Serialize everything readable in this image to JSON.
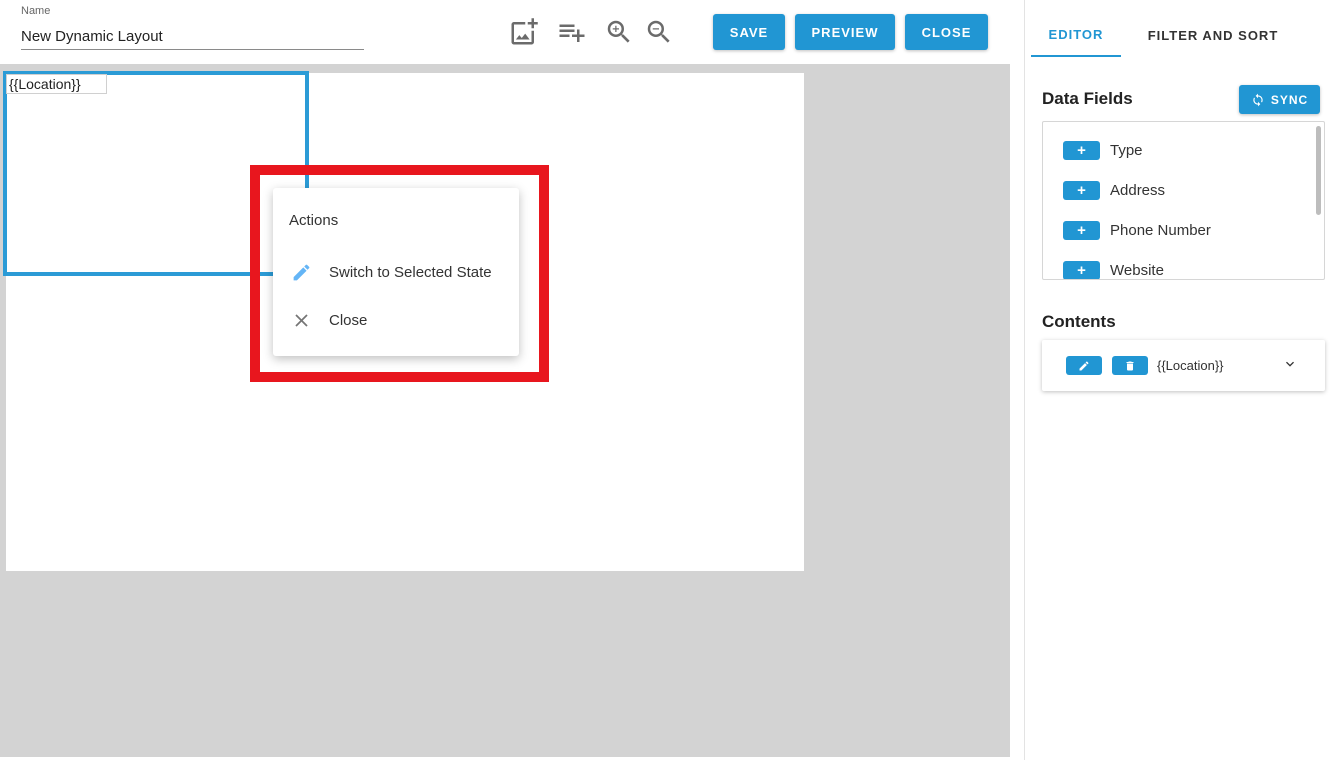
{
  "header": {
    "name_label": "Name",
    "name_value": "New Dynamic Layout",
    "tools": [
      "add-image-icon",
      "add-list-icon",
      "zoom-in-icon",
      "zoom-out-icon"
    ],
    "save_label": "SAVE",
    "preview_label": "PREVIEW",
    "close_label": "CLOSE"
  },
  "canvas": {
    "element_text": "{{Location}}"
  },
  "context_menu": {
    "title": "Actions",
    "items": [
      {
        "label": "Switch to Selected State",
        "icon": "pencil-icon"
      },
      {
        "label": "Close",
        "icon": "close-icon"
      }
    ]
  },
  "panel": {
    "tabs": [
      "EDITOR",
      "FILTER AND SORT"
    ],
    "active_tab": "EDITOR",
    "data_fields_title": "Data Fields",
    "sync_label": "SYNC",
    "fields": [
      "Type",
      "Address",
      "Phone Number",
      "Website"
    ],
    "add_field_symbol": "+",
    "contents_title": "Contents",
    "contents_items": [
      "{{Location}}"
    ]
  },
  "colors": {
    "accent": "#2196d3",
    "highlight": "#e8161e",
    "canvas_bg": "#d3d3d3"
  }
}
